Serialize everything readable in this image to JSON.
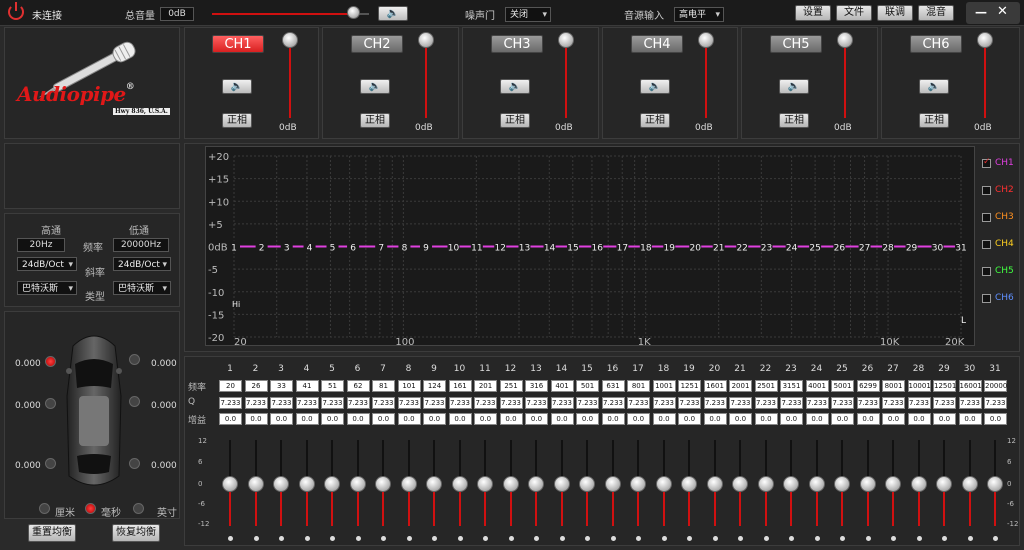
{
  "top": {
    "status": "未连接",
    "master_label": "总音量",
    "master_value": "0dB",
    "noise_gate_label": "噪声门",
    "noise_gate_value": "关闭",
    "source_label": "音源输入",
    "source_value": "高电平",
    "buttons": [
      "设置",
      "文件",
      "联调",
      "混音"
    ],
    "minimize": "—",
    "close": "✕"
  },
  "logo": {
    "brand": "Audiopipe",
    "reg": "®",
    "sub": "Hwy 836, U.S.A."
  },
  "channels": [
    {
      "name": "CH1",
      "group": "正相",
      "db": "0dB",
      "active": true
    },
    {
      "name": "CH2",
      "group": "正相",
      "db": "0dB",
      "active": false
    },
    {
      "name": "CH3",
      "group": "正相",
      "db": "0dB",
      "active": false
    },
    {
      "name": "CH4",
      "group": "正相",
      "db": "0dB",
      "active": false
    },
    {
      "name": "CH5",
      "group": "正相",
      "db": "0dB",
      "active": false
    },
    {
      "name": "CH6",
      "group": "正相",
      "db": "0dB",
      "active": false
    }
  ],
  "crossover": {
    "highpass_label": "高通",
    "lowpass_label": "低通",
    "freq_label": "频率",
    "slope_label": "斜率",
    "type_label": "类型",
    "hp_freq": "20Hz",
    "lp_freq": "20000Hz",
    "hp_slope": "24dB/Oct",
    "lp_slope": "24dB/Oct",
    "hp_type": "巴特沃斯",
    "lp_type": "巴特沃斯"
  },
  "delay": {
    "values": [
      "0.000",
      "0.000",
      "0.000",
      "0.000",
      "0.000",
      "0.000"
    ],
    "units": [
      "厘米",
      "毫秒",
      "英寸"
    ],
    "selected_unit": 1
  },
  "bottom_buttons": [
    "重置均衡",
    "恢复均衡"
  ],
  "graph": {
    "y_labels": [
      "+20",
      "+15",
      "+10",
      "+5",
      "0dB",
      "-5",
      "-10",
      "-15",
      "-20"
    ],
    "x_labels": [
      "20",
      "100",
      "1K",
      "10K",
      "20K"
    ],
    "hi": "Hi",
    "l": "L",
    "points": [
      "1",
      "2",
      "3",
      "4",
      "5",
      "6",
      "7",
      "8",
      "9",
      "10",
      "11",
      "12",
      "13",
      "14",
      "15",
      "16",
      "17",
      "18",
      "19",
      "20",
      "21",
      "22",
      "23",
      "24",
      "25",
      "26",
      "27",
      "28",
      "29",
      "30",
      "31"
    ]
  },
  "legend": [
    {
      "name": "CH1",
      "color": "#e040e0",
      "checked": true
    },
    {
      "name": "CH2",
      "color": "#ff3030",
      "checked": false
    },
    {
      "name": "CH3",
      "color": "#ff9020",
      "checked": false
    },
    {
      "name": "CH4",
      "color": "#ffd020",
      "checked": false
    },
    {
      "name": "CH5",
      "color": "#40ff40",
      "checked": false
    },
    {
      "name": "CH6",
      "color": "#6090ff",
      "checked": false
    }
  ],
  "eq": {
    "row_labels": [
      "频率",
      "Q",
      "增益"
    ],
    "bands": [
      "1",
      "2",
      "3",
      "4",
      "5",
      "6",
      "7",
      "8",
      "9",
      "10",
      "11",
      "12",
      "13",
      "14",
      "15",
      "16",
      "17",
      "18",
      "19",
      "20",
      "21",
      "22",
      "23",
      "24",
      "25",
      "26",
      "27",
      "28",
      "29",
      "30",
      "31"
    ],
    "freqs": [
      "20",
      "26",
      "33",
      "41",
      "51",
      "62",
      "81",
      "101",
      "124",
      "161",
      "201",
      "251",
      "316",
      "401",
      "501",
      "631",
      "801",
      "1001",
      "1251",
      "1601",
      "2001",
      "2501",
      "3151",
      "4001",
      "5001",
      "6299",
      "8001",
      "10001",
      "12501",
      "16001",
      "20000"
    ],
    "q": "7.233",
    "gain": "0.0",
    "scale": [
      "12",
      "6",
      "0",
      "-6",
      "-12"
    ]
  }
}
